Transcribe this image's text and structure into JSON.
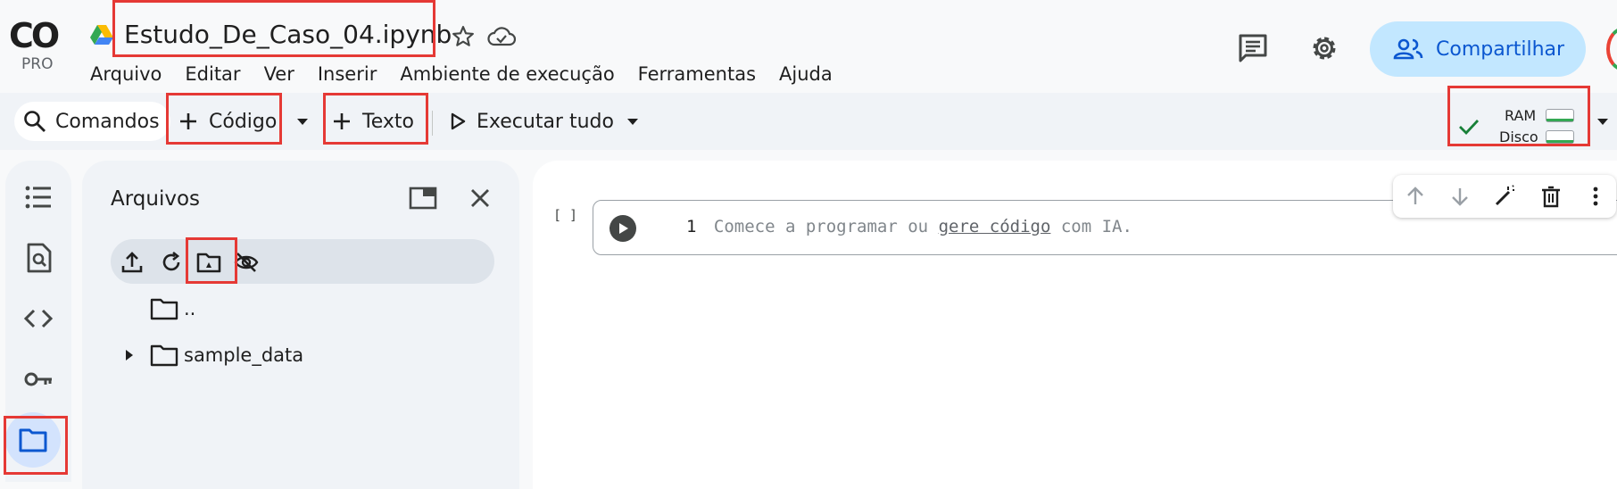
{
  "app": {
    "logo_text": "CO",
    "logo_sub": "PRO",
    "notebook_title": "Estudo_De_Caso_04.ipynb"
  },
  "menu": [
    "Arquivo",
    "Editar",
    "Ver",
    "Inserir",
    "Ambiente de execução",
    "Ferramentas",
    "Ajuda"
  ],
  "header": {
    "share_label": "Compartilhar"
  },
  "toolbar": {
    "commands_label": "Comandos",
    "code_label": "Código",
    "text_label": "Texto",
    "run_all_label": "Executar tudo",
    "ram_label": "RAM",
    "disk_label": "Disco"
  },
  "files_panel": {
    "title": "Arquivos",
    "tree": [
      {
        "name": ".."
      },
      {
        "name": "sample_data"
      }
    ]
  },
  "cell": {
    "bracket": "[ ]",
    "line_number": "1",
    "placeholder_start": "Comece a programar ou ",
    "placeholder_link": "gere código",
    "placeholder_end": " com IA."
  },
  "colors": {
    "highlight": "#e53935",
    "share_bg": "#c2e7ff",
    "accent": "#0b57d0"
  }
}
